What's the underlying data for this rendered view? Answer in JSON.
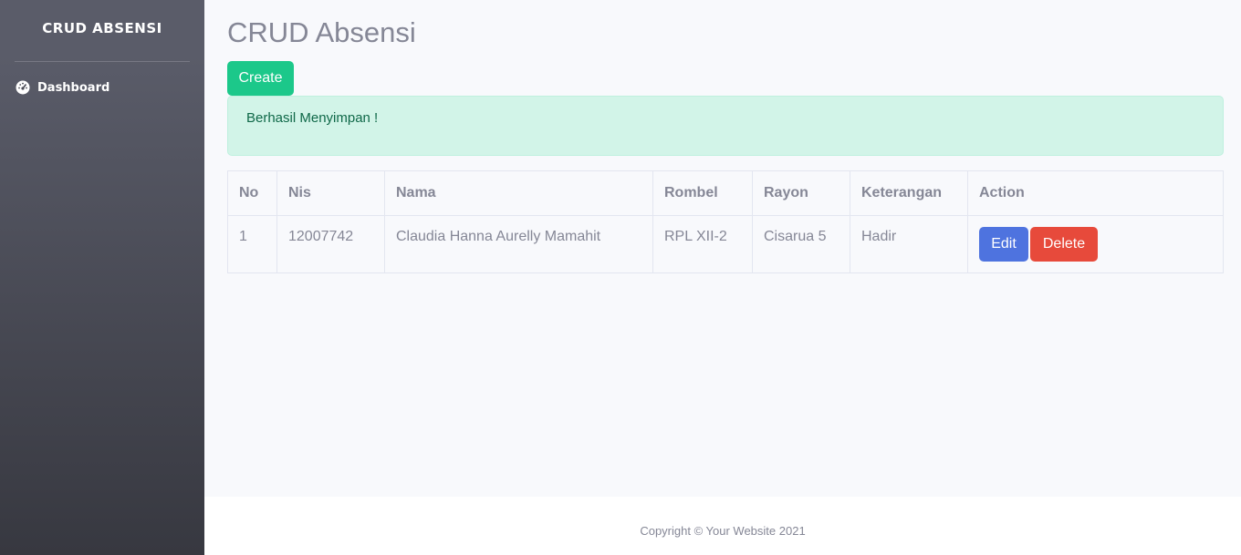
{
  "sidebar": {
    "brand": "CRUD ABSENSI",
    "items": [
      {
        "label": "Dashboard",
        "icon": "tachometer-icon"
      }
    ]
  },
  "main": {
    "title": "CRUD Absensi",
    "create_label": "Create",
    "alert_text": "Berhasil Menyimpan !"
  },
  "table": {
    "headers": [
      "No",
      "Nis",
      "Nama",
      "Rombel",
      "Rayon",
      "Keterangan",
      "Action"
    ],
    "rows": [
      {
        "no": "1",
        "nis": "12007742",
        "nama": "Claudia Hanna Aurelly Mamahit",
        "rombel": "RPL XII-2",
        "rayon": "Cisarua 5",
        "keterangan": "Hadir",
        "edit_label": "Edit",
        "delete_label": "Delete"
      }
    ]
  },
  "footer": {
    "text": "Copyright © Your Website 2021"
  },
  "colors": {
    "sidebar_top": "#5a5c69",
    "sidebar_bottom": "#373840",
    "success": "#1cc88a",
    "primary": "#4e73df",
    "danger": "#e74a3b",
    "alert_bg": "#d2f4e8"
  }
}
